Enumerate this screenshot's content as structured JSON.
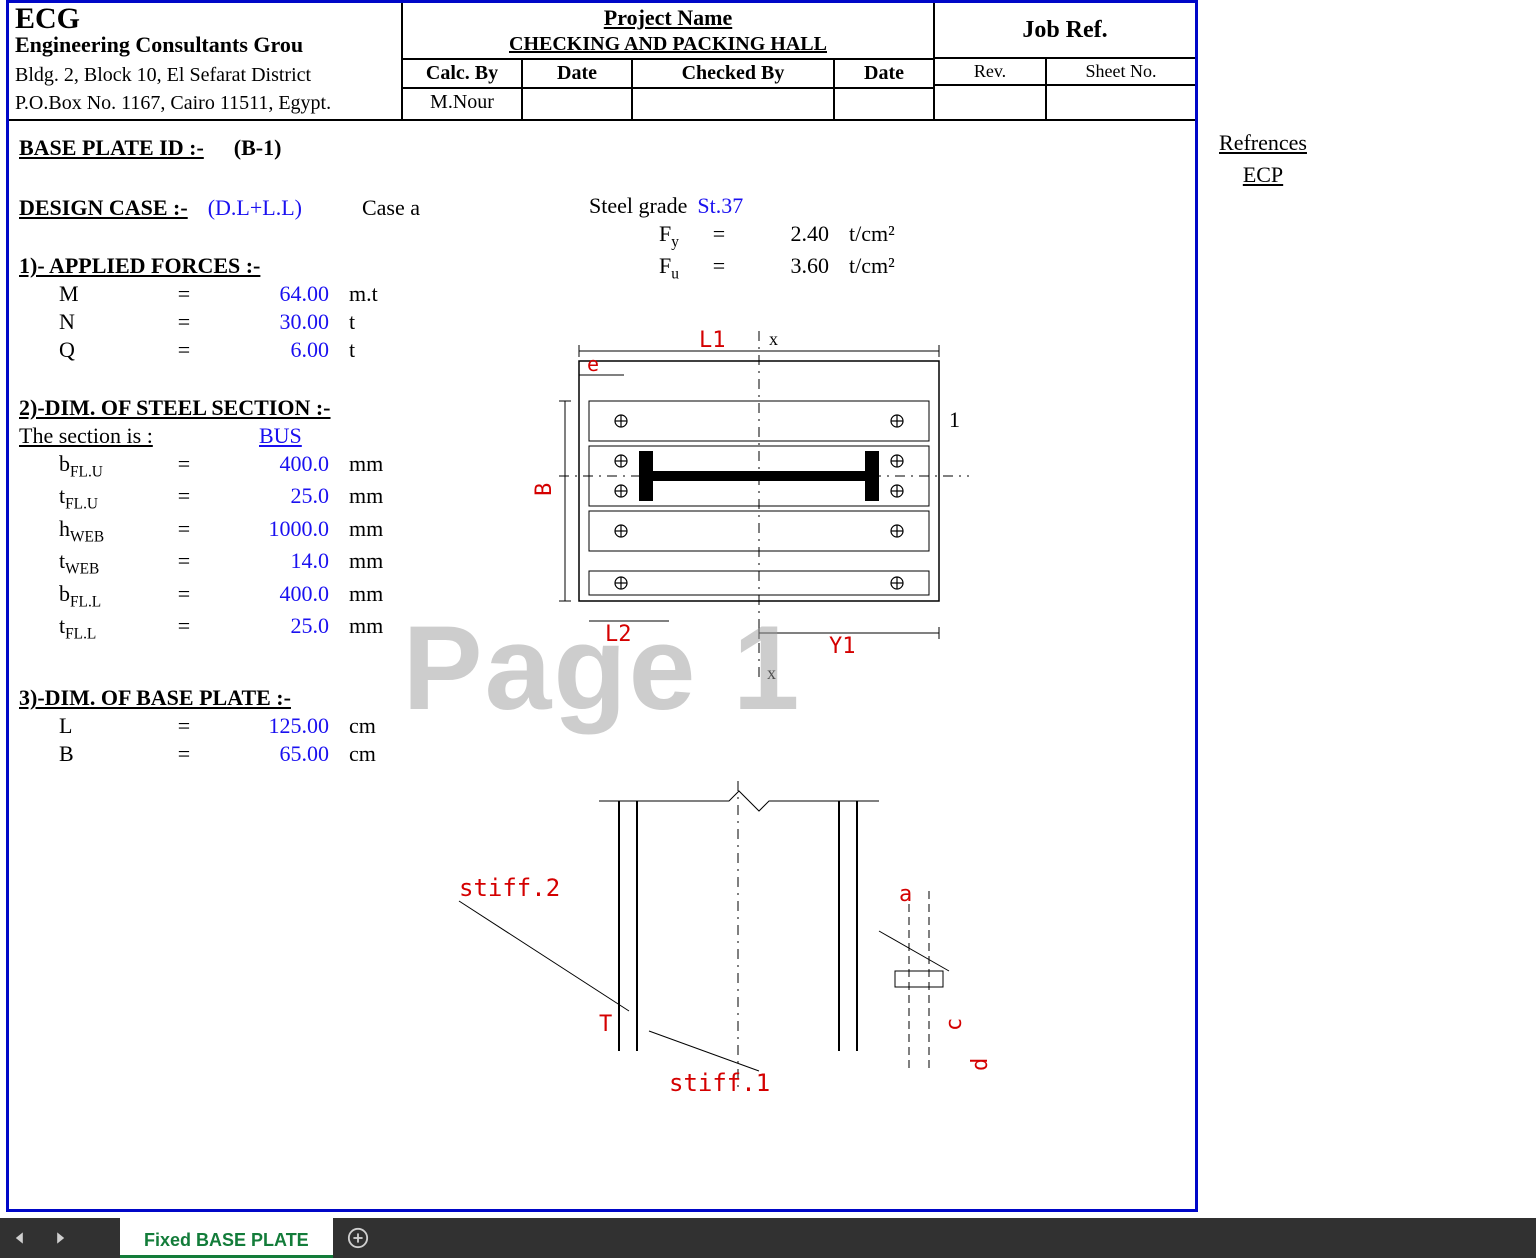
{
  "header": {
    "company_short": "ECG",
    "company_full": "Engineering Consultants Grou",
    "address1": "Bldg. 2, Block 10, El Sefarat District",
    "address2": "P.O.Box No. 1167, Cairo 11511, Egypt.",
    "project_label": "Project Name",
    "project_value": "CHECKING AND PACKING HALL",
    "calc_by_label": "Calc. By",
    "calc_by": "M.Nour",
    "date_label": "Date",
    "date": "",
    "checked_by_label": "Checked By",
    "checked_by": "",
    "date2_label": "Date",
    "date2": "",
    "job_ref_label": "Job Ref.",
    "rev_label": "Rev.",
    "rev": "",
    "sheet_label": "Sheet No.",
    "sheet": ""
  },
  "refs": {
    "title": "Refrences",
    "code": "ECP"
  },
  "baseplate": {
    "label": "BASE PLATE ID :-",
    "id": "(B-1)"
  },
  "design_case": {
    "label": "DESIGN CASE :-",
    "value": "(D.L+L.L)",
    "case": "Case a"
  },
  "steel": {
    "grade_label": "Steel grade",
    "grade": "St.37",
    "Fy_label": "F",
    "Fy_sub": "y",
    "Fy": "2.40",
    "Fy_unit": "t/cm²",
    "Fu_label": "F",
    "Fu_sub": "u",
    "Fu": "3.60",
    "Fu_unit": "t/cm²"
  },
  "forces": {
    "heading": "1)- APPLIED FORCES :-",
    "items": [
      {
        "sym": "M",
        "val": "64.00",
        "unit": "m.t"
      },
      {
        "sym": "N",
        "val": "30.00",
        "unit": "t"
      },
      {
        "sym": "Q",
        "val": "6.00",
        "unit": "t"
      }
    ]
  },
  "section": {
    "heading": "2)-DIM. OF STEEL SECTION :-",
    "is_label": "The section is :",
    "is_value": "BUS",
    "items": [
      {
        "sym": "b",
        "sub": "FL.U",
        "val": "400.0",
        "unit": "mm"
      },
      {
        "sym": "t",
        "sub": "FL.U",
        "val": "25.0",
        "unit": "mm"
      },
      {
        "sym": "h",
        "sub": "WEB",
        "val": "1000.0",
        "unit": "mm"
      },
      {
        "sym": "t",
        "sub": "WEB",
        "val": "14.0",
        "unit": "mm"
      },
      {
        "sym": "b",
        "sub": "FL.L",
        "val": "400.0",
        "unit": "mm"
      },
      {
        "sym": "t",
        "sub": "FL.L",
        "val": "25.0",
        "unit": "mm"
      }
    ]
  },
  "plate": {
    "heading": "3)-DIM. OF BASE PLATE :-",
    "items": [
      {
        "sym": "L",
        "val": "125.00",
        "unit": "cm"
      },
      {
        "sym": "B",
        "val": "65.00",
        "unit": "cm"
      }
    ]
  },
  "diagram": {
    "L1": "L1",
    "L2": "L2",
    "Y1": "Y1",
    "B": "B",
    "e": "e",
    "one": "1",
    "x": "x",
    "xtop": "x",
    "stiff1": "stiff.1",
    "stiff2": "stiff.2",
    "a": "a",
    "d": "d",
    "c": "c",
    "T": "T"
  },
  "watermark": "Page 1",
  "tabs": {
    "active": "Fixed BASE PLATE"
  }
}
